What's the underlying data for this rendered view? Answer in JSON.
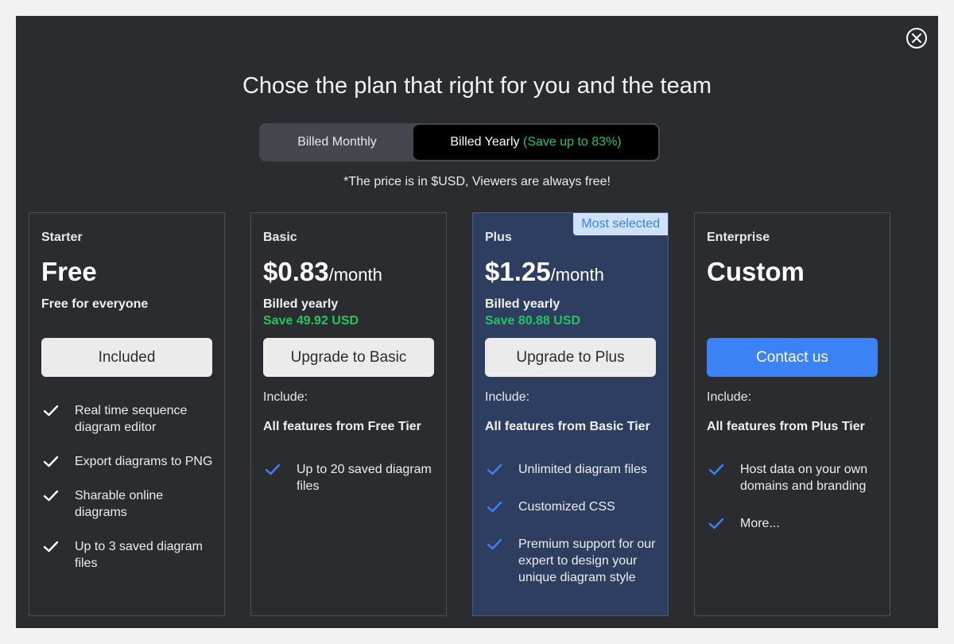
{
  "title": "Chose the plan that right for you and the team",
  "billing": {
    "monthly_label": "Billed Monthly",
    "yearly_label": "Billed Yearly",
    "yearly_save": "(Save up to 83%)"
  },
  "note": "*The price is in $USD, Viewers are always free!",
  "colors": {
    "accent": "#3b82f6",
    "save": "#22c55e",
    "modal_bg": "#2b2c30",
    "plus_bg": "#2e3e60"
  },
  "plans": [
    {
      "tier": "Starter",
      "price": "Free",
      "subtitle": "Free for everyone",
      "button": "Included",
      "features": [
        "Real time sequence diagram editor",
        "Export diagrams to PNG",
        "Sharable online diagrams",
        "Up to 3 saved diagram files"
      ]
    },
    {
      "tier": "Basic",
      "price": "$0.83",
      "period": "/month",
      "billed": "Billed yearly",
      "save": "Save 49.92 USD",
      "button": "Upgrade to Basic",
      "include": "Include:",
      "all_features": "All features from Free Tier",
      "features": [
        "Up to 20 saved diagram files"
      ]
    },
    {
      "tier": "Plus",
      "badge": "Most selected",
      "price": "$1.25",
      "period": "/month",
      "billed": "Billed yearly",
      "save": "Save 80.88 USD",
      "button": "Upgrade to Plus",
      "include": "Include:",
      "all_features": "All features from Basic Tier",
      "features": [
        "Unlimited diagram files",
        "Customized CSS",
        "Premium support for our expert to design your unique diagram style"
      ]
    },
    {
      "tier": "Enterprise",
      "price": "Custom",
      "button": "Contact us",
      "include": "Include:",
      "all_features": "All features from Plus Tier",
      "features": [
        "Host data on your own domains and branding",
        "More..."
      ]
    }
  ]
}
